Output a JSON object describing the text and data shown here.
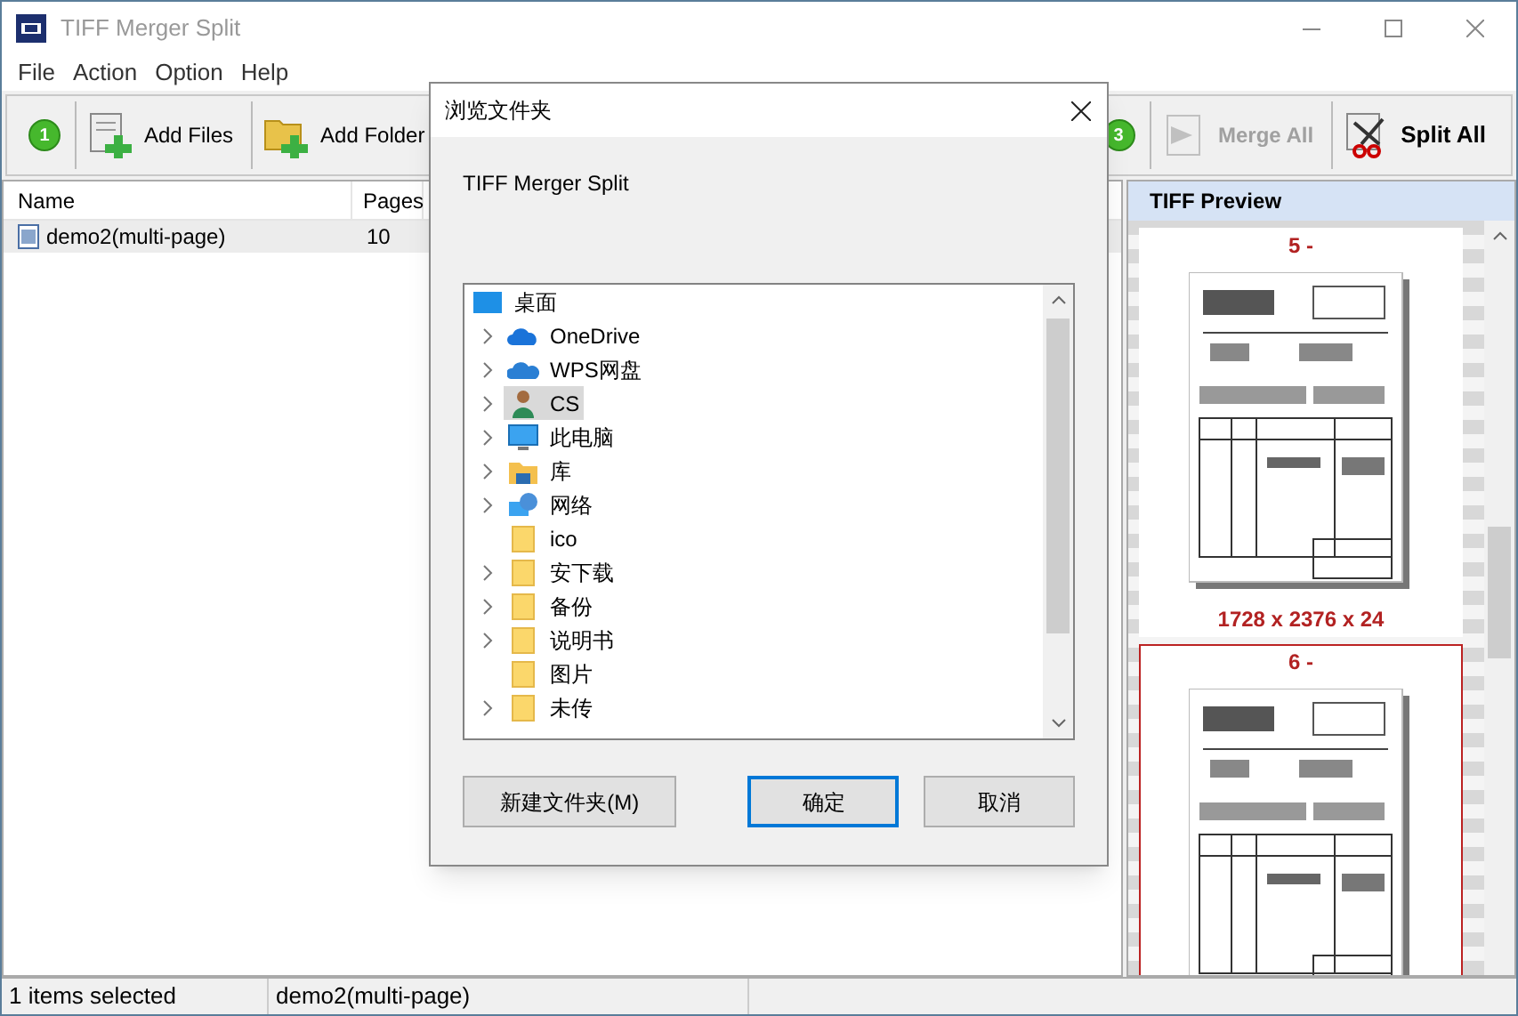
{
  "window": {
    "title": "TIFF Merger Split",
    "active": false
  },
  "menu": [
    "File",
    "Action",
    "Option",
    "Help"
  ],
  "toolbar": [
    {
      "kind": "step",
      "label": "1"
    },
    {
      "kind": "add_files",
      "label": "Add Files",
      "disabled": false
    },
    {
      "kind": "add_folder",
      "label": "Add Folder",
      "disabled": false
    },
    {
      "kind": "spacer"
    },
    {
      "kind": "step",
      "label": "3"
    },
    {
      "kind": "merge",
      "label": "Merge All",
      "disabled": true
    },
    {
      "kind": "split",
      "label": "Split All",
      "disabled": false
    }
  ],
  "file_list": {
    "columns": [
      "Name",
      "Pages"
    ],
    "rows": [
      {
        "name": "demo2(multi-page)",
        "pages": "10",
        "selected": true
      }
    ]
  },
  "preview": {
    "title": "TIFF Preview",
    "pages": [
      {
        "label": "5 -",
        "dimensions": "1728 x 2376 x 24",
        "selected": false
      },
      {
        "label": "6 -",
        "selected": true
      }
    ]
  },
  "status_bar": [
    "1 items selected",
    "demo2(multi-page)"
  ],
  "dialog": {
    "title": "浏览文件夹",
    "description": "TIFF Merger Split",
    "tree": {
      "label": "桌面",
      "kind": "desktop",
      "selected": false,
      "children": [
        {
          "label": "OneDrive",
          "kind": "cloud",
          "expandable": true,
          "selected": false
        },
        {
          "label": "WPS网盘",
          "kind": "cloud2",
          "expandable": true,
          "selected": false
        },
        {
          "label": "CS",
          "kind": "user",
          "expandable": true,
          "selected": true
        },
        {
          "label": "此电脑",
          "kind": "pc",
          "expandable": true,
          "selected": false
        },
        {
          "label": "库",
          "kind": "library",
          "expandable": true,
          "selected": false
        },
        {
          "label": "网络",
          "kind": "network",
          "expandable": true,
          "selected": false
        },
        {
          "label": "ico",
          "kind": "folder",
          "expandable": false,
          "selected": false
        },
        {
          "label": "安下载",
          "kind": "folder",
          "expandable": true,
          "selected": false
        },
        {
          "label": "备份",
          "kind": "folder",
          "expandable": true,
          "selected": false
        },
        {
          "label": "说明书",
          "kind": "folder",
          "expandable": true,
          "selected": false
        },
        {
          "label": "图片",
          "kind": "folder",
          "expandable": false,
          "selected": false
        },
        {
          "label": "未传",
          "kind": "folder",
          "expandable": true,
          "selected": false
        }
      ]
    },
    "buttons": [
      {
        "label": "新建文件夹(M)",
        "default": false
      },
      {
        "label": "确定",
        "default": true
      },
      {
        "label": "取消",
        "default": false
      }
    ]
  }
}
